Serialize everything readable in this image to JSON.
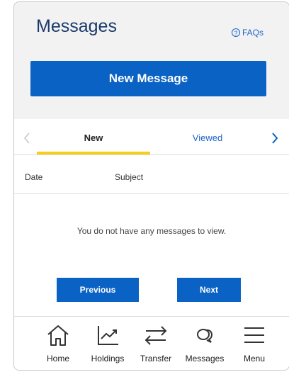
{
  "header": {
    "title": "Messages",
    "faq_label": "FAQs",
    "faq_icon": "?",
    "new_message_label": "New Message"
  },
  "tabs": {
    "items": [
      {
        "label": "New",
        "active": true
      },
      {
        "label": "Viewed",
        "active": false
      }
    ]
  },
  "table": {
    "columns": [
      "Date",
      "Subject"
    ],
    "empty_text": "You do not have any messages to view."
  },
  "pager": {
    "previous_label": "Previous",
    "next_label": "Next"
  },
  "bottom_nav": {
    "items": [
      {
        "label": "Home",
        "icon": "home-icon"
      },
      {
        "label": "Holdings",
        "icon": "chart-trend-icon"
      },
      {
        "label": "Transfer",
        "icon": "transfer-arrows-icon"
      },
      {
        "label": "Messages",
        "icon": "chat-bubbles-icon"
      },
      {
        "label": "Menu",
        "icon": "hamburger-icon"
      }
    ]
  },
  "colors": {
    "primary": "#0a62c4",
    "title": "#1b3a6b",
    "link": "#1b63c7",
    "tab_underline": "#f5cf1a",
    "header_bg": "#f2f2f2"
  }
}
